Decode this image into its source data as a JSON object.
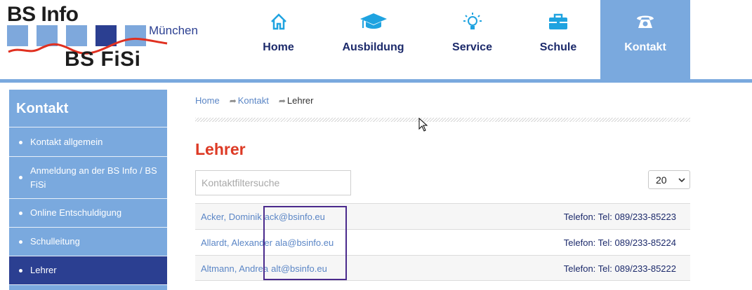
{
  "logo": {
    "top": "BS Info",
    "bottom": "BS FiSi",
    "city": "München"
  },
  "nav": [
    {
      "label": "Home",
      "icon": "home-icon",
      "active": false
    },
    {
      "label": "Ausbildung",
      "icon": "graduation-cap-icon",
      "active": false
    },
    {
      "label": "Service",
      "icon": "lightbulb-icon",
      "active": false
    },
    {
      "label": "Schule",
      "icon": "briefcase-icon",
      "active": false
    },
    {
      "label": "Kontakt",
      "icon": "telephone-icon",
      "active": true
    }
  ],
  "sidebar": {
    "title": "Kontakt",
    "items": [
      {
        "label": "Kontakt allgemein",
        "active": false
      },
      {
        "label": "Anmeldung an der BS Info / BS FiSi",
        "active": false
      },
      {
        "label": "Online Entschuldigung",
        "active": false
      },
      {
        "label": "Schulleitung",
        "active": false
      },
      {
        "label": "Lehrer",
        "active": true
      }
    ]
  },
  "breadcrumb": {
    "home": "Home",
    "kontakt": "Kontakt",
    "current": "Lehrer"
  },
  "page": {
    "title": "Lehrer"
  },
  "filter": {
    "placeholder": "Kontaktfiltersuche",
    "page_size": "20"
  },
  "contacts": [
    {
      "name": "Acker, Dominik",
      "email": "ack@bsinfo.eu",
      "phone": "Telefon: Tel: 089/233-85223"
    },
    {
      "name": "Allardt, Alexander",
      "email": "ala@bsinfo.eu",
      "phone": "Telefon: Tel: 089/233-85224"
    },
    {
      "name": "Altmann, Andrea",
      "email": "alt@bsinfo.eu",
      "phone": "Telefon: Tel: 089/233-85222"
    }
  ],
  "colors": {
    "accent_blue": "#7aa9de",
    "dark_blue": "#2b3f91",
    "title_red": "#dd3a25",
    "nav_icon": "#1fa3e0"
  }
}
